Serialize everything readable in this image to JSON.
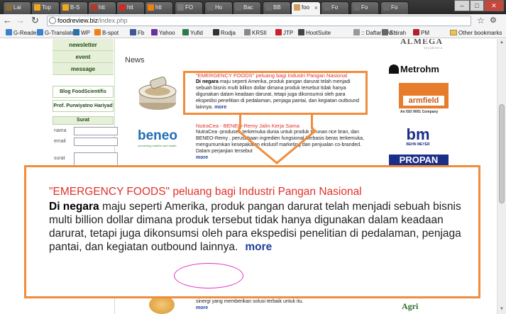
{
  "tabs": [
    {
      "label": "Lai",
      "fav": "#8a6b3a"
    },
    {
      "label": "Top",
      "fav": "#f2a81d"
    },
    {
      "label": "B-S",
      "fav": "#f2a81d"
    },
    {
      "label": "htt",
      "fav": "#b23a2a"
    },
    {
      "label": "htt",
      "fav": "#cf2a2a"
    },
    {
      "label": "htt",
      "fav": "#f07f12"
    },
    {
      "label": "FO",
      "fav": "#7a7a7a"
    },
    {
      "label": "Ho",
      "fav": "#6a6a6a"
    },
    {
      "label": "Bac",
      "fav": "#6a6a6a"
    },
    {
      "label": "BB",
      "fav": "#6a6a6a"
    },
    {
      "label": "foo",
      "fav": "#d2a15e",
      "active": true
    },
    {
      "label": "Fo",
      "fav": "#6a6a6a"
    },
    {
      "label": "Fo",
      "fav": "#6a6a6a"
    },
    {
      "label": "Fo",
      "fav": "#6a6a6a"
    }
  ],
  "address": {
    "host": "foodreview.biz",
    "path": "/index.php"
  },
  "bookmarks": [
    {
      "label": "G-Reader",
      "color": "#3a7fd0"
    },
    {
      "label": "G-Translate",
      "color": "#3a7fd0"
    },
    {
      "label": "WP",
      "color": "#2a6fa8"
    },
    {
      "label": "B-spot",
      "color": "#f07f12"
    },
    {
      "label": "Fb",
      "color": "#3b5998"
    },
    {
      "label": "Yahoo",
      "color": "#6d2f9f"
    },
    {
      "label": "Yufid",
      "color": "#2b7a4b"
    },
    {
      "label": "Rodja",
      "color": "#333"
    },
    {
      "label": "KRSII",
      "color": "#888"
    },
    {
      "label": "JTP",
      "color": "#c8202a"
    },
    {
      "label": "HootSuite",
      "color": "#444"
    },
    {
      "label": ":: Daftar SNI ::",
      "color": "#999"
    },
    {
      "label": "Shirah",
      "color": "#666"
    },
    {
      "label": "PM",
      "color": "#b02030"
    }
  ],
  "other_bookmarks": "Other bookmarks",
  "sidebar": {
    "menu": [
      "newsletter",
      "event",
      "message"
    ],
    "blog": "Blog FoodScientifis",
    "prof": "Prof. Purwiyatno Hariyad",
    "surat_title": "Surat",
    "form_labels": [
      "nama",
      "email",
      "surat"
    ]
  },
  "news": {
    "heading": "News",
    "item1": {
      "title": "\"EMERGENCY FOODS\" peluang bagi Industri Pangan Nasional",
      "lead": "Di negara",
      "body": " maju seperti Amerika, produk pangan darurat telah menjadi sebuah bisnis multi billion dollar dimana produk tersebut tidak hanya digunakan dalam keadaan darurat, tetapi juga dikonsumsi oleh para ekspedisi penelitian di pedalaman, penjaga pantai, dan kegiatan outbound lainnya.",
      "more": "more"
    },
    "item2": {
      "title": "NutraCea - BENEO-Remy Jalin Kerja Sama",
      "body": "NutraCea -produsen terkemuka dunia untuk produk turunan rice bran, dan BENEO-Remy , perusahaan ingredien fungsional berbasis beras terkemuka, mengumumkan kesepakatan ekslusif marketing dan penjualan co-branded. Dalam perjanjian tersebut",
      "more": "more"
    },
    "beneo_logo": "beneo",
    "beneo_tag": "connecting nutrition and health",
    "bottom_text": "sinergi yang memberikan solusi terbaik untuk itu.",
    "bottom_more": "more"
  },
  "logos": {
    "almega": "ALMEGA",
    "almega_sub": "sejahtera",
    "metrohm": "Metrohm",
    "armfield": "armfield",
    "armfield_sub": "An ISO 9001 Company",
    "bm": "bm",
    "bm_sub": "BEHN MEYER",
    "propan": "PROPAN",
    "agri": "Agri"
  },
  "zoom": {
    "title": "\"EMERGENCY FOODS\" peluang bagi Industri Pangan Nasional",
    "lead": "Di negara",
    "body": " maju seperti Amerika, produk pangan darurat telah menjadi sebuah bisnis multi billion dollar dimana produk tersebut tidak hanya digunakan dalam keadaan darurat, tetapi juga dikonsumsi oleh para ekspedisi penelitian di pedalaman, penjaga pantai, dan kegiatan outbound lainnya.",
    "more": "more"
  },
  "colors": {
    "accent": "#f08d3c",
    "highlight": "#e030c8",
    "title_red": "#e0302a",
    "link_blue": "#1c3f9a"
  }
}
